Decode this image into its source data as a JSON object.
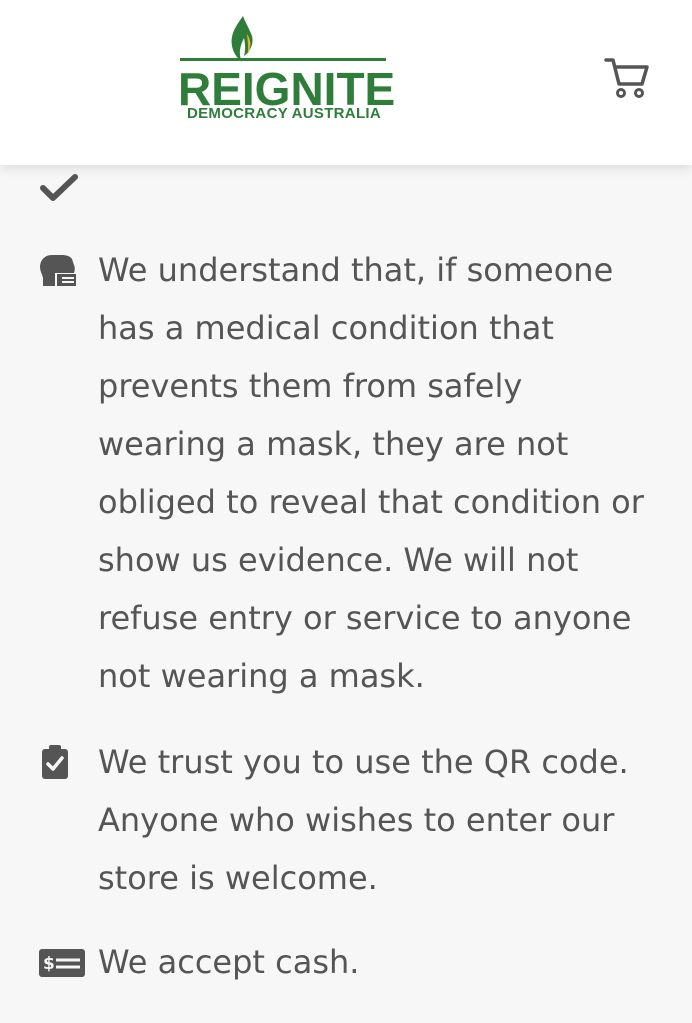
{
  "header": {
    "logo_title": "REIGNITE",
    "logo_subtitle": "DEMOCRACY AUSTRALIA",
    "cart_icon": "cart-icon",
    "brand_color": "#2f7d3a"
  },
  "policies": [
    {
      "icon": "head-side-mask-icon",
      "text": "We understand that, if someone has a medical condition that prevents them from safely wearing a mask, they are not obliged to reveal that condition or show us evidence. We will not refuse entry or service to anyone not wearing a mask."
    },
    {
      "icon": "clipboard-check-icon",
      "text": "We trust you to use the QR code. Anyone who wishes to enter our store is welcome."
    },
    {
      "icon": "money-check-icon",
      "text": "We accept cash."
    }
  ]
}
